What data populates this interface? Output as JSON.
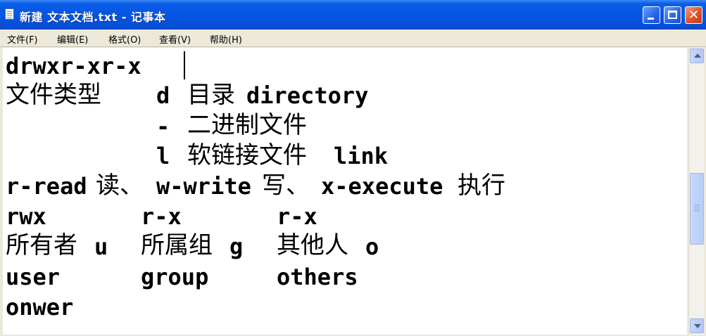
{
  "window": {
    "title": "新建 文本文档.txt - 记事本",
    "buttons": {
      "minimize": "minimize",
      "maximize": "maximize",
      "close": "✕"
    }
  },
  "menu": [
    {
      "label": "文件(F)"
    },
    {
      "label": "编辑(E)"
    },
    {
      "label": "格式(O)"
    },
    {
      "label": "查看(V)"
    },
    {
      "label": "帮助(H)"
    }
  ],
  "editor": {
    "l1": "drwxr-xr-x",
    "l2a": "文件类型",
    "l2b": "d",
    "l2c": "目录",
    "l2d": "directory",
    "l3a": "-",
    "l3b": "二进制文件",
    "l4a": "l",
    "l4b": "软链接文件",
    "l4c": "link",
    "l5a": "r-read",
    "l5b": "读、",
    "l5c": "w-write",
    "l5d": "写、",
    "l5e": "x-execute",
    "l5f": "执行",
    "l6a": "rwx",
    "l6b": "r-x",
    "l6c": "r-x",
    "l7a": "所有者",
    "l7b": "u",
    "l7c": "所属组",
    "l7d": "g",
    "l7e": "其他人",
    "l7f": "o",
    "l8a": "user",
    "l8b": "group",
    "l8c": "others",
    "l9a": "onwer"
  }
}
